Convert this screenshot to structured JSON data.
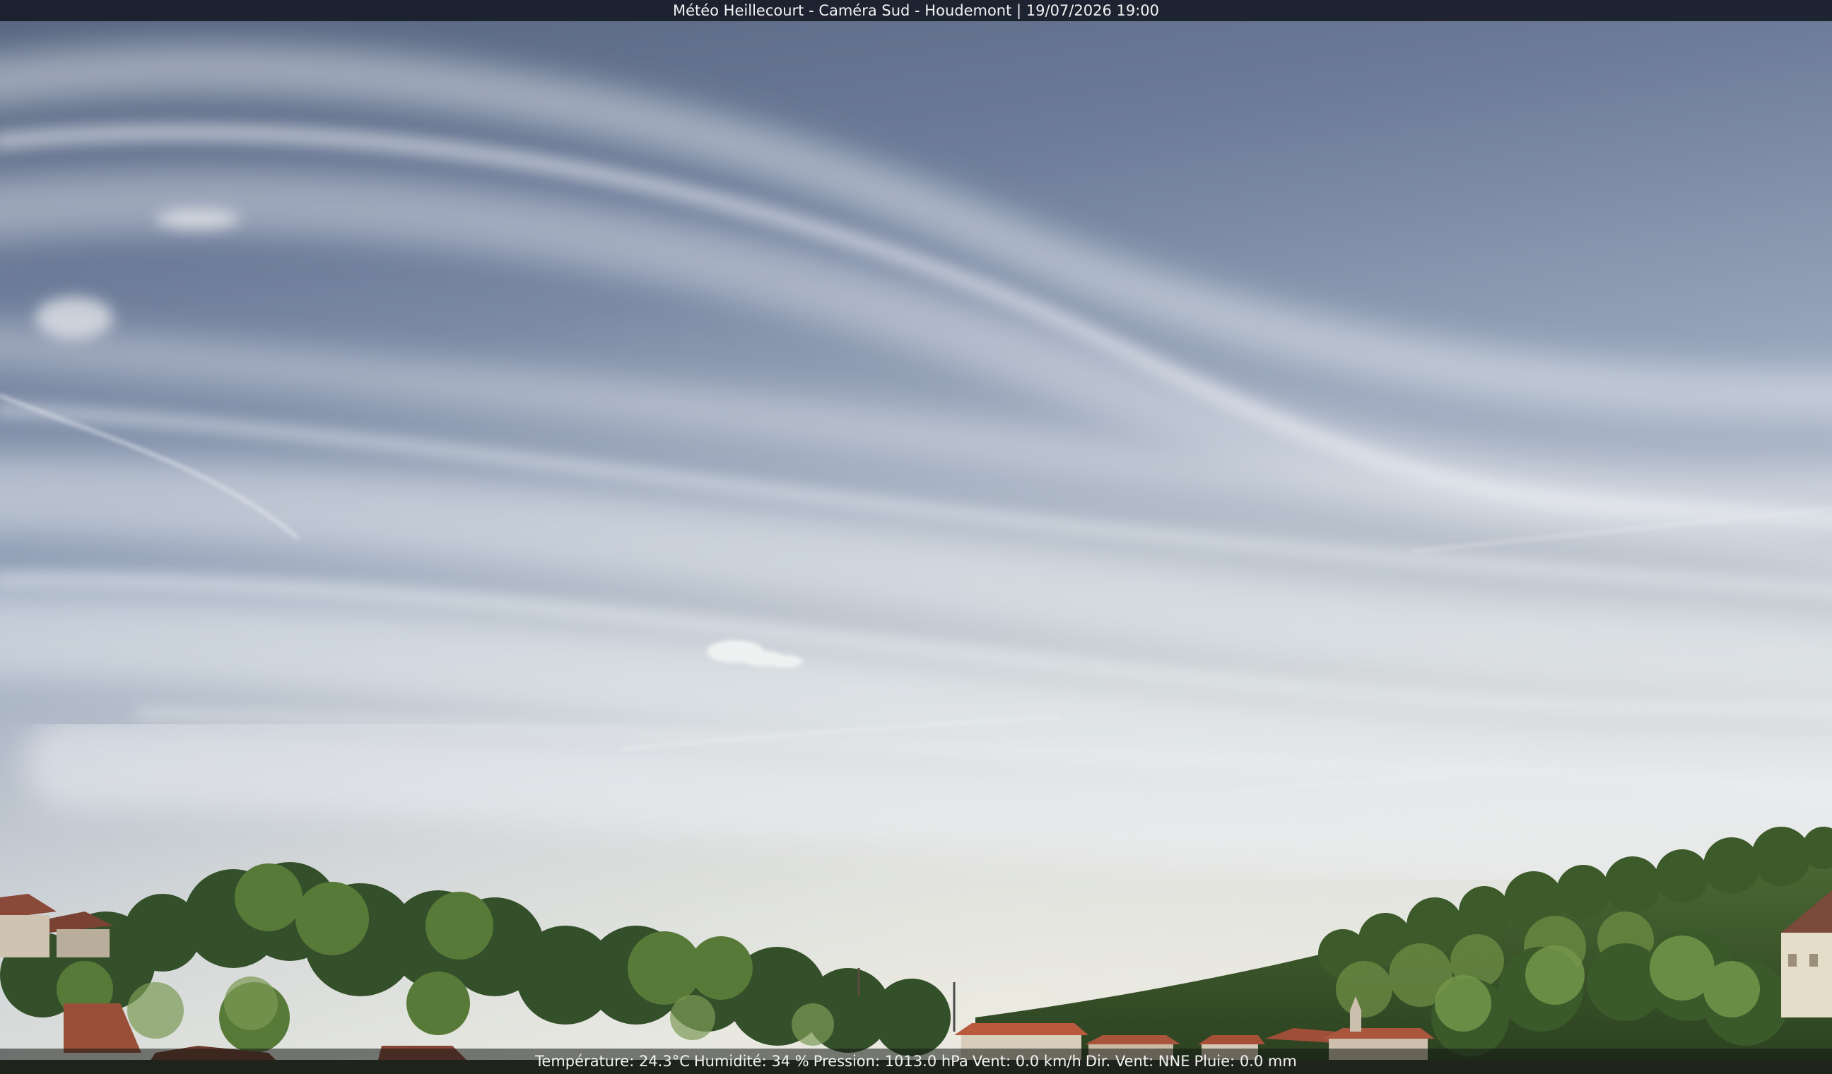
{
  "header": {
    "title": "Météo Heillecourt - Caméra Sud - Houdemont | 19/07/2026 19:00"
  },
  "footer": {
    "temperature": "Température: 24.3°C",
    "humidity": "Humidité: 34 %",
    "pressure": "Pression: 1013.0 hPa",
    "wind": "Vent: 0.0 km/h",
    "wind_direction": "Dir. Vent: NNE",
    "rain": "Pluie: 0.0 mm"
  },
  "colors": {
    "sky_top": "#5b6a8c",
    "sky_mid": "#8e9db8",
    "sky_horizon": "#d6dad8",
    "cloud": "#e9ecef",
    "vegetation_dark": "#2f4a25",
    "vegetation_light": "#6a8a3e",
    "roof": "#a0553d"
  }
}
